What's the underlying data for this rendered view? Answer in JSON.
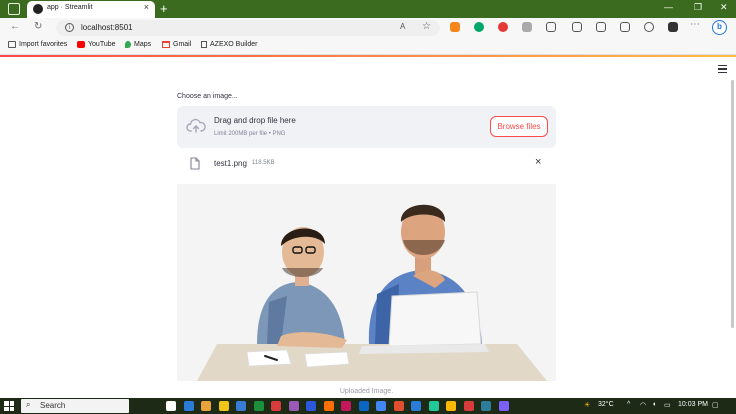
{
  "browser": {
    "tab_title": "app · Streamlit",
    "tab_close": "×",
    "new_tab": "+",
    "window_controls": [
      "—",
      "❐",
      "✕"
    ],
    "url": "localhost:8501",
    "bookmarks": [
      "Import favorites",
      "YouTube",
      "Maps",
      "Gmail",
      "AZEXO Builder"
    ],
    "extension_colors": [
      "#f6851b",
      "#00a86b",
      "#e53935",
      "#888888",
      "#555555",
      "#555555",
      "#555555",
      "#555555",
      "#555555",
      "#333333"
    ]
  },
  "uploader": {
    "label": "Choose an image...",
    "drop_title": "Drag and drop file here",
    "limit": "Limit 200MB per file • PNG",
    "browse_label": "Browse files"
  },
  "file": {
    "name": "test1.png",
    "size": "118.5KB",
    "remove": "×"
  },
  "image": {
    "caption": "Uploaded Image."
  },
  "taskbar": {
    "search_placeholder": "Search",
    "temperature": "32°C",
    "time": "10:03 PM",
    "app_colors": [
      "#ffffff",
      "#2b7bd8",
      "#e8a33b",
      "#f0c419",
      "#3a7bd5",
      "#1b8f3a",
      "#d83b3b",
      "#9b59b6",
      "#2b57d8",
      "#ff6f00",
      "#c2185b",
      "#0a66c2",
      "#4285f4",
      "#e04f2f",
      "#2b7bd8",
      "#20c997",
      "#ffb900",
      "#d83b3b",
      "#2d7d9a",
      "#7b61ff"
    ]
  },
  "colors": {
    "accent": "#ff4b4b",
    "accent2": "#ffbd45"
  }
}
